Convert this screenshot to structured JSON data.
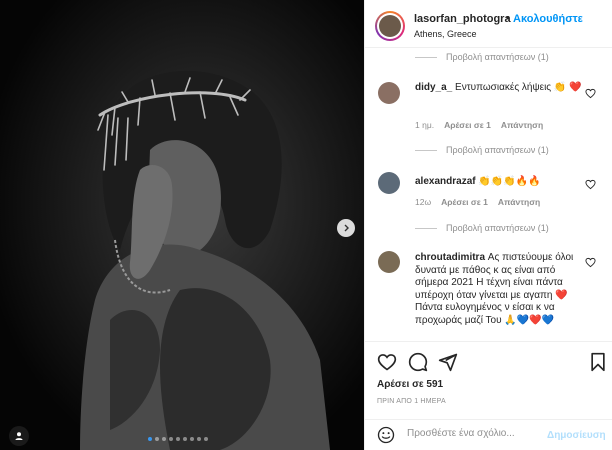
{
  "post": {
    "username": "lasorfan_photogra",
    "separator": "•",
    "follow_label": "Ακολουθήστε",
    "location": "Athens, Greece"
  },
  "comments": [
    {
      "type": "view_replies",
      "label": "Προβολή απαντήσεων (1)"
    },
    {
      "author": "didy_a_",
      "text": "Εντυπωσιακές λήψεις 👏 ❤️",
      "time": "1 ημ.",
      "likes": "Αρέσει σε 1",
      "reply": "Απάντηση",
      "replies": "Προβολή απαντήσεων (1)"
    },
    {
      "author": "alexandrazaf",
      "text": "👏👏👏🔥🔥",
      "time": "12ω",
      "likes": "Αρέσει σε 1",
      "reply": "Απάντηση",
      "replies": "Προβολή απαντήσεων (1)"
    },
    {
      "author": "chroutadimitra",
      "text": "Ας πιστεύουμε όλοι δυνατά με πάθος κ ας είναι από σήμερα 2021 Η τέχνη είναι πάντα υπέροχη όταν γίνεται με αγαπη ❤️ Πάντα ευλογημένος ν είσαι κ να προχωράς μαζί Του 🙏💙❤️💙"
    }
  ],
  "actions": {
    "likes": "Αρέσει σε 591",
    "date": "ΠΡΙΝ ΑΠΟ 1 ΗΜΕΡΑ"
  },
  "composer": {
    "placeholder": "Προσθέστε ένα σχόλιο...",
    "post_label": "Δημοσίευση"
  },
  "carousel": {
    "total": 9,
    "active": 1
  },
  "colors": {
    "link_blue": "#0095f6",
    "disabled_blue": "#b2dffc",
    "muted_gray": "#8e8e8e",
    "carousel_dot_active": "#3897f0"
  },
  "icons": [
    "chevron-right-icon",
    "user-tag-icon",
    "heart-icon",
    "comment-icon",
    "share-icon",
    "bookmark-icon",
    "emoji-icon"
  ]
}
